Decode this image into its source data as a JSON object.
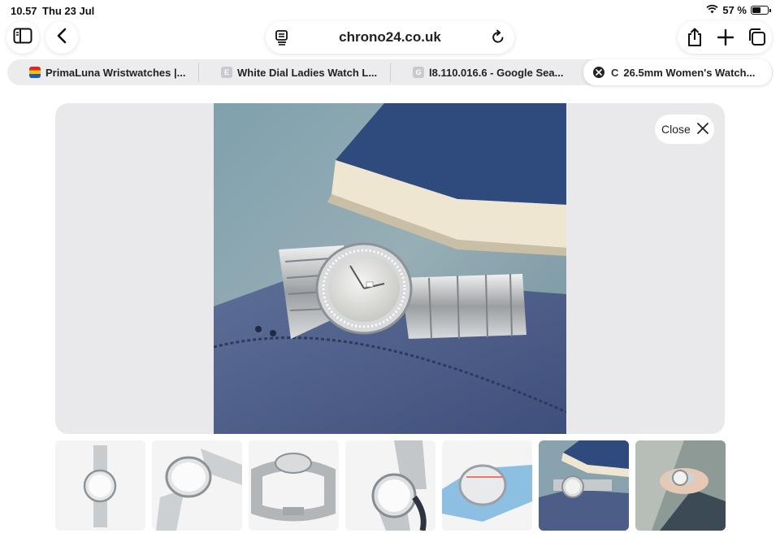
{
  "status": {
    "time": "10.57",
    "date": "Thu 23 Jul",
    "battery": "57 %",
    "battery_level": 0.57
  },
  "toolbar": {
    "url": "chrono24.co.uk"
  },
  "tabs": [
    {
      "title": "PrimaLuna Wristwatches |..."
    },
    {
      "title": "White Dial Ladies Watch L...",
      "favicon_letter": "E"
    },
    {
      "title": "l8.110.016.6 - Google Sea...",
      "favicon_letter": "G"
    },
    {
      "title": "26.5mm Women's Watch...",
      "favicon_letter": "C"
    }
  ],
  "viewer": {
    "close_label": "Close"
  },
  "thumbnails": {
    "count": 7,
    "selected_index": 5
  },
  "colors": {
    "accent_bg": "#e9e9eb",
    "tabbar_bg": "#ececef"
  }
}
